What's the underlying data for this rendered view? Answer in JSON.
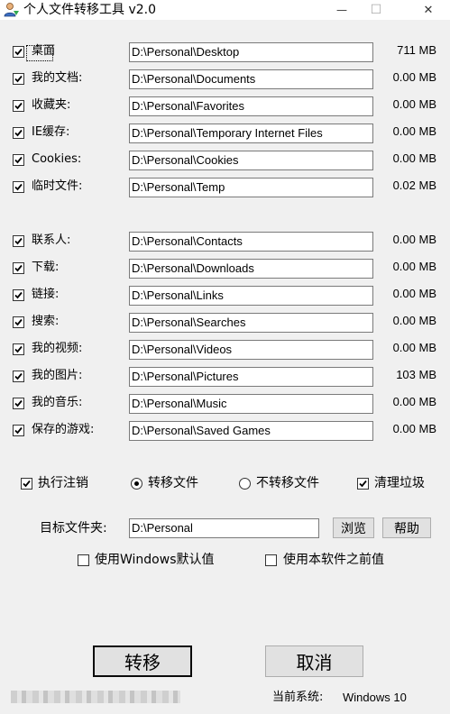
{
  "window": {
    "title": "个人文件转移工具 v2.0",
    "minimize_glyph": "—",
    "maximize_glyph": "☐",
    "close_glyph": "✕"
  },
  "groups": [
    [
      {
        "label": "桌面",
        "path": "D:\\Personal\\Desktop",
        "size": "711  MB",
        "checked": true,
        "focused": true
      },
      {
        "label": "我的文档:",
        "path": "D:\\Personal\\Documents",
        "size": "0.00 MB",
        "checked": true
      },
      {
        "label": "收藏夹:",
        "path": "D:\\Personal\\Favorites",
        "size": "0.00 MB",
        "checked": true
      },
      {
        "label": "IE缓存:",
        "path": "D:\\Personal\\Temporary Internet Files",
        "size": "0.00 MB",
        "checked": true
      },
      {
        "label": "Cookies:",
        "path": "D:\\Personal\\Cookies",
        "size": "0.00 MB",
        "checked": true
      },
      {
        "label": "临时文件:",
        "path": "D:\\Personal\\Temp",
        "size": "0.02 MB",
        "checked": true
      }
    ],
    [
      {
        "label": "联系人:",
        "path": "D:\\Personal\\Contacts",
        "size": "0.00 MB",
        "checked": true
      },
      {
        "label": "下载:",
        "path": "D:\\Personal\\Downloads",
        "size": "0.00 MB",
        "checked": true
      },
      {
        "label": "链接:",
        "path": "D:\\Personal\\Links",
        "size": "0.00 MB",
        "checked": true
      },
      {
        "label": "搜索:",
        "path": "D:\\Personal\\Searches",
        "size": "0.00 MB",
        "checked": true
      },
      {
        "label": "我的视频:",
        "path": "D:\\Personal\\Videos",
        "size": "0.00 MB",
        "checked": true
      },
      {
        "label": "我的图片:",
        "path": "D:\\Personal\\Pictures",
        "size": "103  MB",
        "checked": true
      },
      {
        "label": "我的音乐:",
        "path": "D:\\Personal\\Music",
        "size": "0.00 MB",
        "checked": true
      },
      {
        "label": "保存的游戏:",
        "path": "D:\\Personal\\Saved Games",
        "size": "0.00 MB",
        "checked": true
      }
    ]
  ],
  "options": {
    "execute_logout": {
      "label": "执行注销",
      "checked": true
    },
    "move_files": {
      "label": "转移文件",
      "selected": true
    },
    "no_move_files": {
      "label": "不转移文件",
      "selected": false
    },
    "clean_junk": {
      "label": "清理垃圾",
      "checked": true
    }
  },
  "target": {
    "label": "目标文件夹:",
    "value": "D:\\Personal",
    "browse_label": "浏览",
    "help_label": "帮助"
  },
  "defaults": {
    "use_windows_default": {
      "label": "使用Windows默认值",
      "checked": false
    },
    "use_previous": {
      "label": "使用本软件之前值",
      "checked": false
    }
  },
  "actions": {
    "transfer_label": "转移",
    "cancel_label": "取消"
  },
  "status": {
    "system_label": "当前系统:",
    "system_value": "Windows 10"
  }
}
